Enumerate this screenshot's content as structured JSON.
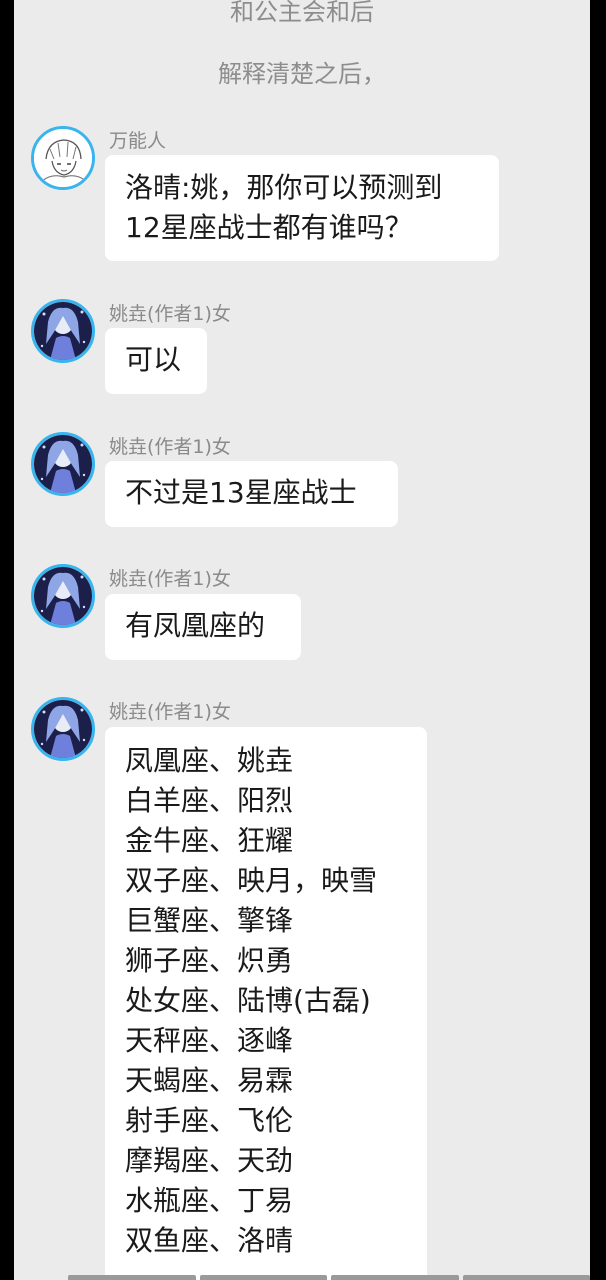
{
  "narration": [
    "和公主会和后",
    "解释清楚之后，"
  ],
  "messages": [
    {
      "sender": "万能人",
      "avatar_icon": "sketch-character-avatar",
      "lines": [
        "洛晴:姚，那你可以预测到",
        "12星座战士都有谁吗？"
      ]
    },
    {
      "sender": "姚垚(作者1)女",
      "avatar_icon": "anime-girl-blue-avatar",
      "lines": [
        "可以"
      ]
    },
    {
      "sender": "姚垚(作者1)女",
      "avatar_icon": "anime-girl-blue-avatar",
      "lines": [
        "不过是13星座战士"
      ]
    },
    {
      "sender": "姚垚(作者1)女",
      "avatar_icon": "anime-girl-blue-avatar",
      "lines": [
        "有凤凰座的"
      ]
    },
    {
      "sender": "姚垚(作者1)女",
      "avatar_icon": "anime-girl-blue-avatar",
      "lines": [
        "凤凰座、姚垚",
        "白羊座、阳烈",
        "金牛座、狂耀",
        "双子座、映月，映雪",
        "巨蟹座、擎锋",
        "狮子座、炽勇",
        "处女座、陆博(古磊)",
        "天秤座、逐峰",
        "天蝎座、易霖",
        "射手座、飞伦",
        "摩羯座、天劲",
        "水瓶座、丁易",
        "双鱼座、洛晴"
      ]
    }
  ],
  "colors": {
    "background": "#ebebeb",
    "bubble": "#ffffff",
    "avatar_ring": "#38b4ee",
    "name_text": "#8a8a8a",
    "narration_text": "#8d8d8d"
  }
}
